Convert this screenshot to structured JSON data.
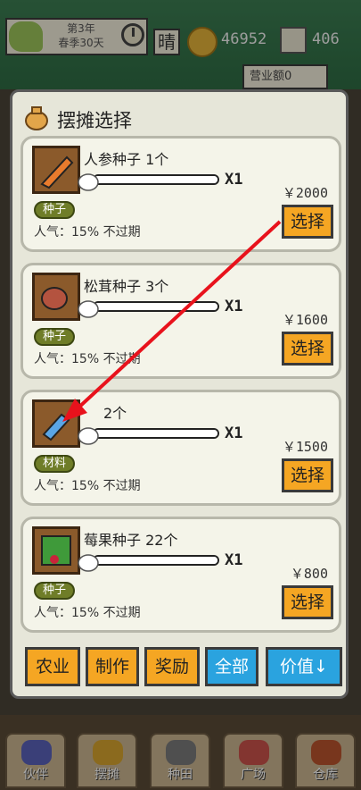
{
  "status_bar": {
    "date_line1": "第3年",
    "date_line2": "春季30天",
    "weather": "晴",
    "coins": "46952",
    "gems": "406",
    "revenue_label": "营业额0"
  },
  "nav": {
    "items": [
      {
        "label": "伙伴",
        "icon": "partner-icon"
      },
      {
        "label": "摆摊",
        "icon": "stall-icon"
      },
      {
        "label": "种田",
        "icon": "farm-icon"
      },
      {
        "label": "广场",
        "icon": "plaza-icon"
      },
      {
        "label": "仓库",
        "icon": "warehouse-icon"
      }
    ]
  },
  "modal": {
    "title": "摆摊选择",
    "title_icon": "bag-icon",
    "items": [
      {
        "name": "人参种子 1个",
        "tag": "种子",
        "desc": "人气：15%  不过期",
        "price": "￥2000",
        "mult": "X1",
        "select": "选择",
        "icon": "ginseng-seed-icon",
        "icon_color": "#e87b2d"
      },
      {
        "name": "松茸种子 3个",
        "tag": "种子",
        "desc": "人气：15%  不过期",
        "price": "￥1600",
        "mult": "X1",
        "select": "选择",
        "icon": "matsutake-seed-icon",
        "icon_color": "#b4533f"
      },
      {
        "name": "2个",
        "tag": "材料",
        "desc": "人气：15%  不过期",
        "price": "￥1500",
        "mult": "X1",
        "select": "选择",
        "icon": "crystal-material-icon",
        "icon_color": "#5aa6e6"
      },
      {
        "name": "莓果种子 22个",
        "tag": "种子",
        "desc": "人气：15%  不过期",
        "price": "￥800",
        "mult": "X1",
        "select": "选择",
        "icon": "berry-seed-icon",
        "icon_color": "#3f9a3a"
      }
    ],
    "filters": [
      {
        "label": "农业",
        "style": "orange"
      },
      {
        "label": "制作",
        "style": "orange"
      },
      {
        "label": "奖励",
        "style": "orange"
      },
      {
        "label": "全部",
        "style": "blue"
      },
      {
        "label": "价值↓",
        "style": "blue"
      }
    ]
  },
  "annotation": {
    "arrow_color": "#e8121c"
  }
}
